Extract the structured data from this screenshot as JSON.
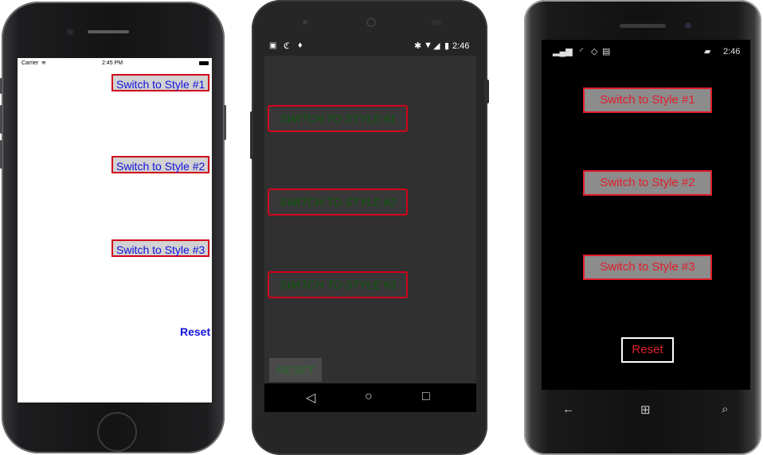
{
  "ios": {
    "status": {
      "carrier": "Carrier",
      "time": "2:45 PM"
    },
    "buttons": [
      "Switch to Style #1",
      "Switch to Style #2",
      "Switch to Style #3"
    ],
    "reset": "Reset"
  },
  "android": {
    "status": {
      "time": "2:46"
    },
    "buttons": [
      "SWITCH TO STYLE #1",
      "SWITCH TO STYLE #2",
      "SWITCH TO STYLE #3"
    ],
    "reset": "RESET",
    "nav": {
      "back": "◁",
      "home": "○",
      "recents": "□"
    }
  },
  "windows": {
    "status": {
      "time": "2:46"
    },
    "buttons": [
      "Switch to Style #1",
      "Switch to Style #2",
      "Switch to Style #3"
    ],
    "reset": "Reset"
  },
  "colors": {
    "button_border": "#d0021b",
    "ios_text": "#1111dd",
    "android_text": "#0a5a0a",
    "windows_text": "#e11d2b"
  }
}
